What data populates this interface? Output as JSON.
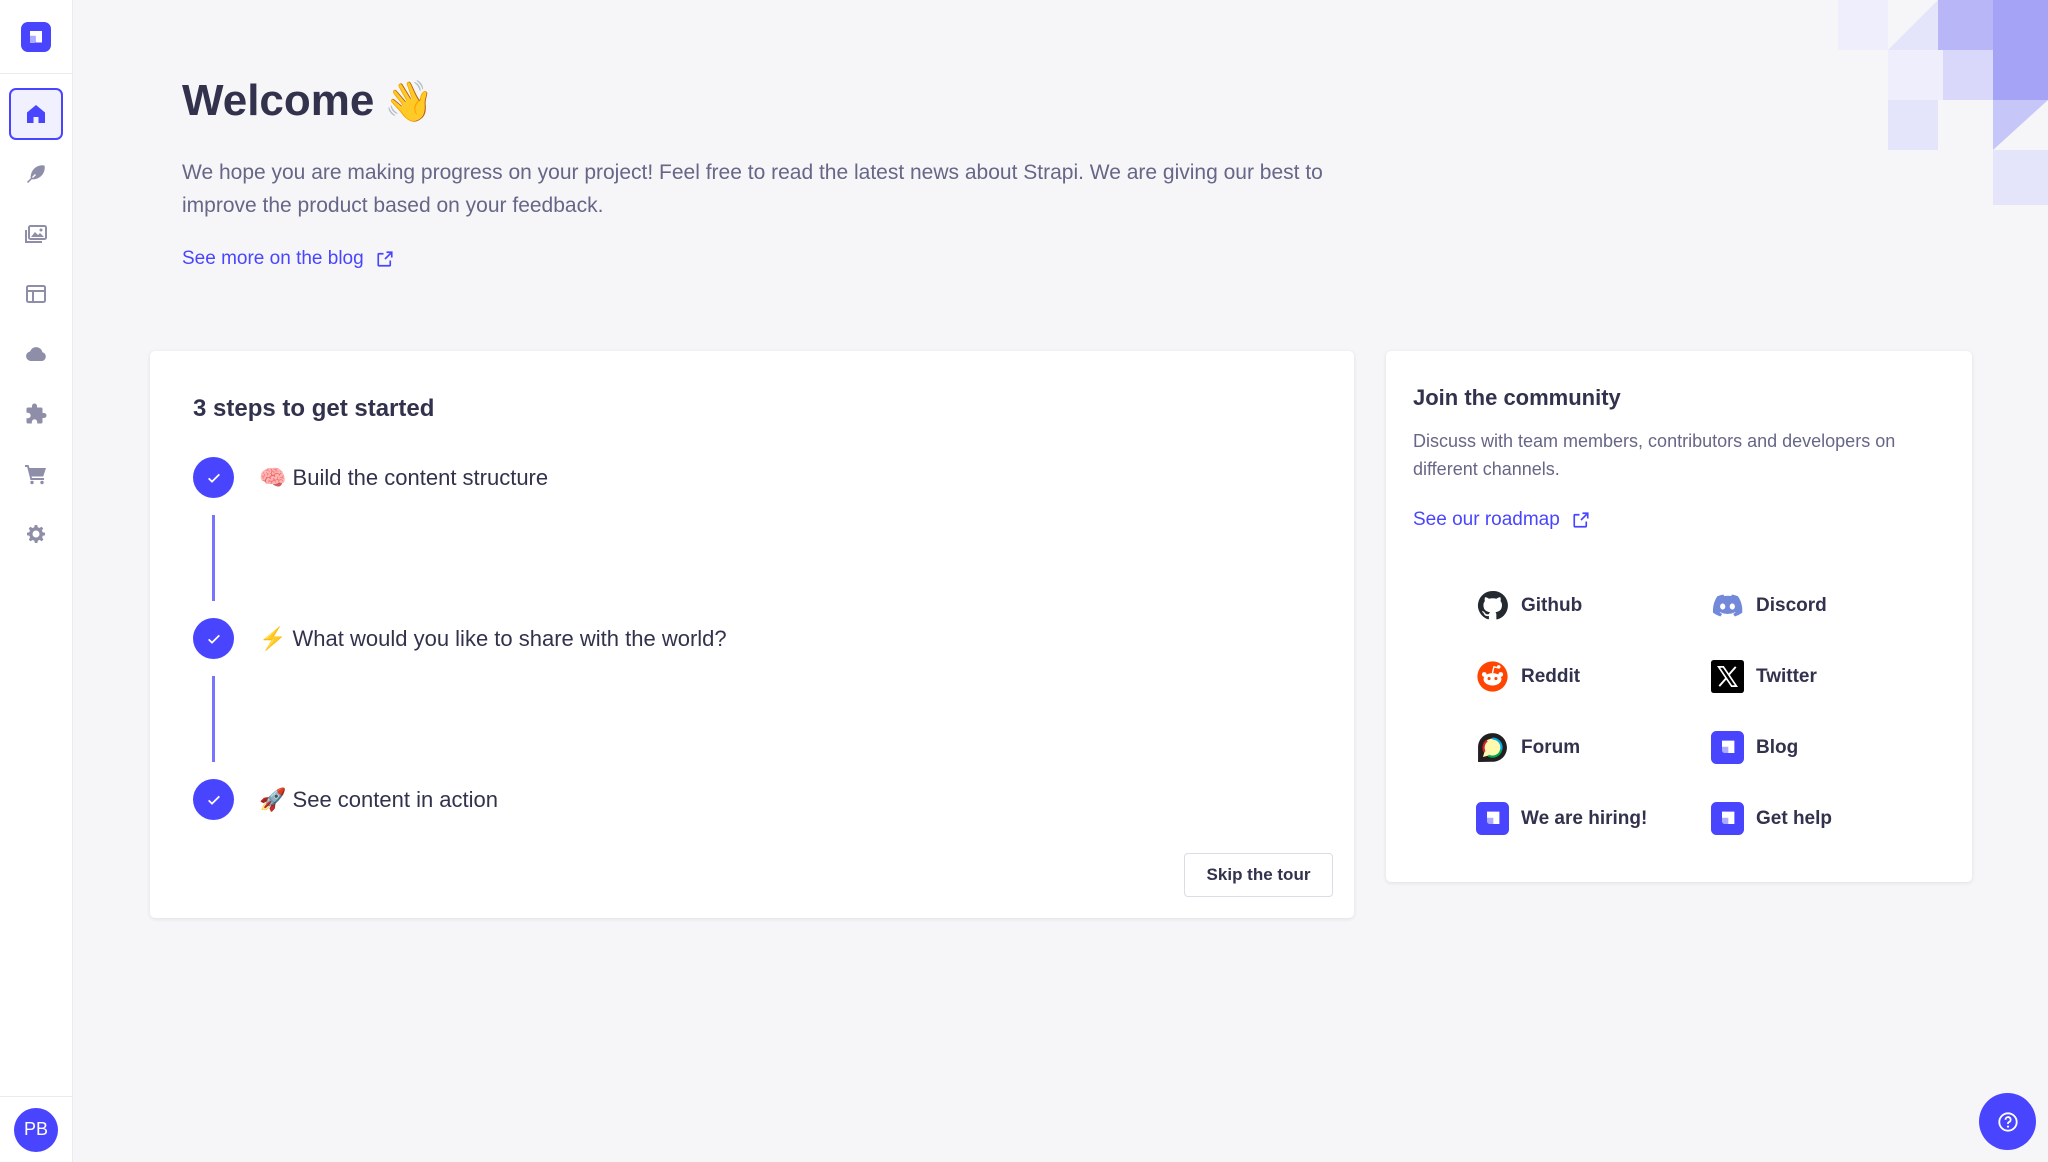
{
  "sidebar": {
    "logo": "strapi-logo",
    "items": [
      {
        "name": "home",
        "icon": "home-icon",
        "active": true
      },
      {
        "name": "content-manager",
        "icon": "feather-icon"
      },
      {
        "name": "media-library",
        "icon": "images-icon"
      },
      {
        "name": "content-type-builder",
        "icon": "layout-icon"
      },
      {
        "name": "deploy",
        "icon": "cloud-icon"
      },
      {
        "name": "plugins",
        "icon": "puzzle-icon"
      },
      {
        "name": "marketplace",
        "icon": "cart-icon"
      },
      {
        "name": "settings",
        "icon": "gear-icon"
      }
    ],
    "user_initials": "PB"
  },
  "header": {
    "title": "Welcome",
    "title_emoji": "👋",
    "intro": "We hope you are making progress on your project! Feel free to read the latest news about Strapi. We are giving our best to improve the product based on your feedback.",
    "blog_link": "See more on the blog"
  },
  "steps": {
    "title": "3 steps to get started",
    "items": [
      {
        "emoji": "🧠",
        "label": "Build the content structure",
        "done": true
      },
      {
        "emoji": "⚡️",
        "label": "What would you like to share with the world?",
        "done": true
      },
      {
        "emoji": "🚀",
        "label": "See content in action",
        "done": true
      }
    ],
    "skip_label": "Skip the tour"
  },
  "community": {
    "title": "Join the community",
    "description": "Discuss with team members, contributors and developers on different channels.",
    "roadmap_link": "See our roadmap",
    "links": [
      {
        "label": "Github",
        "icon": "github-icon"
      },
      {
        "label": "Discord",
        "icon": "discord-icon"
      },
      {
        "label": "Reddit",
        "icon": "reddit-icon"
      },
      {
        "label": "Twitter",
        "icon": "x-twitter-icon"
      },
      {
        "label": "Forum",
        "icon": "forum-icon"
      },
      {
        "label": "Blog",
        "icon": "strapi-icon"
      },
      {
        "label": "We are hiring!",
        "icon": "strapi-icon"
      },
      {
        "label": "Get help",
        "icon": "strapi-icon"
      }
    ]
  },
  "colors": {
    "primary": "#4945ff",
    "background": "#f6f6f9",
    "text": "#32324d",
    "muted": "#666687"
  }
}
